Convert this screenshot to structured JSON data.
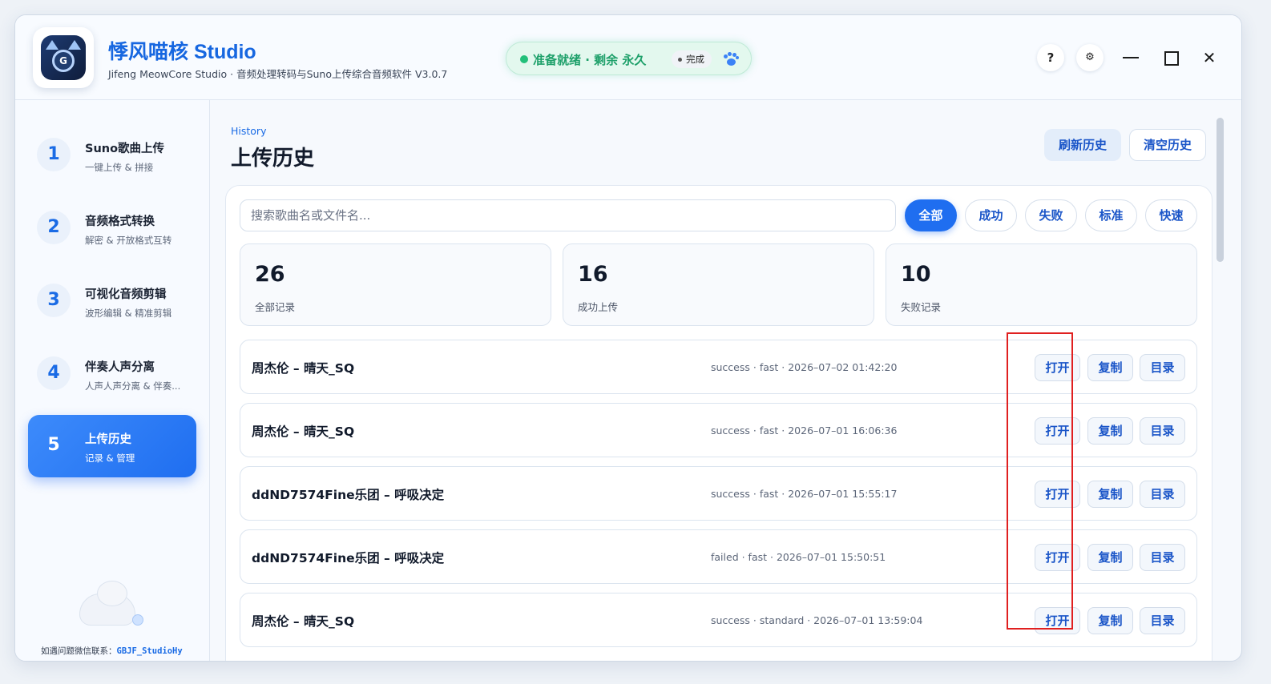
{
  "app": {
    "title": "悸风喵核 Studio",
    "subtitle": "Jifeng MeowCore Studio · 音频处理转码与Suno上传综合音频软件 V3.0.7",
    "logo_letter": "G"
  },
  "status": {
    "text": "准备就绪 · 剩余 永久",
    "badge": "完成",
    "color": "#22c07a"
  },
  "header_buttons": {
    "help": "?",
    "settings": "⚙"
  },
  "window_controls": {
    "close": "✕"
  },
  "sidebar": {
    "items": [
      {
        "num": "1",
        "title": "Suno歌曲上传",
        "desc": "一键上传 & 拼接"
      },
      {
        "num": "2",
        "title": "音频格式转换",
        "desc": "解密 & 开放格式互转"
      },
      {
        "num": "3",
        "title": "可视化音频剪辑",
        "desc": "波形编辑 & 精准剪辑"
      },
      {
        "num": "4",
        "title": "伴奏人声分离",
        "desc": "人声人声分离 & 伴奏..."
      },
      {
        "num": "5",
        "title": "上传历史",
        "desc": "记录 & 管理"
      }
    ],
    "active_index": 4,
    "contact_label": "如遇问题微信联系：",
    "contact_id": "GBJF_StudioHy"
  },
  "page": {
    "breadcrumb": "History",
    "title": "上传历史",
    "refresh_label": "刷新历史",
    "clear_label": "清空历史"
  },
  "search": {
    "placeholder": "搜索歌曲名或文件名...",
    "value": ""
  },
  "filters": [
    {
      "label": "全部",
      "active": true
    },
    {
      "label": "成功",
      "active": false
    },
    {
      "label": "失败",
      "active": false
    },
    {
      "label": "标准",
      "active": false
    },
    {
      "label": "快速",
      "active": false
    }
  ],
  "stats": [
    {
      "value": "26",
      "label": "全部记录"
    },
    {
      "value": "16",
      "label": "成功上传"
    },
    {
      "value": "10",
      "label": "失败记录"
    }
  ],
  "records": [
    {
      "title": "周杰伦 – 晴天_SQ",
      "meta": "success · fast · 2026–07–02 01:42:20"
    },
    {
      "title": "周杰伦 – 晴天_SQ",
      "meta": "success · fast · 2026–07–01 16:06:36"
    },
    {
      "title": "ddND7574Fine乐团 – 呼吸决定",
      "meta": "success · fast · 2026–07–01 15:55:17"
    },
    {
      "title": "ddND7574Fine乐团 – 呼吸决定",
      "meta": "failed · fast · 2026–07–01 15:50:51"
    },
    {
      "title": "周杰伦 – 晴天_SQ",
      "meta": "success · standard · 2026–07–01 13:59:04"
    }
  ],
  "record_actions": {
    "open": "打开",
    "copy": "复制",
    "folder": "目录"
  },
  "colors": {
    "accent": "#1f6ef0",
    "highlight": "#e02020"
  }
}
